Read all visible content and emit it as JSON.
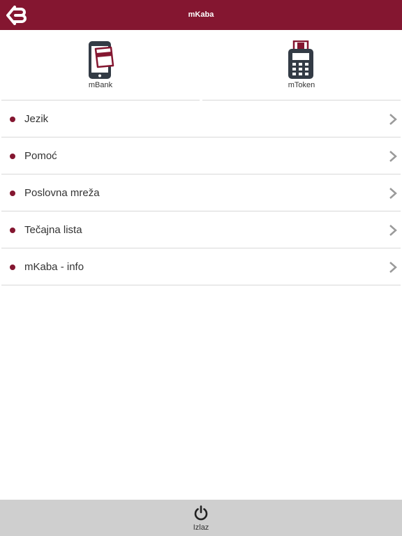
{
  "header": {
    "title": "mKaba",
    "logo_icon": "bank-logo-icon",
    "color": "#841630"
  },
  "tiles": [
    {
      "label": "mBank",
      "icon": "mobile-phone-card-icon"
    },
    {
      "label": "mToken",
      "icon": "token-device-icon"
    }
  ],
  "menu": {
    "items": [
      {
        "label": "Jezik"
      },
      {
        "label": "Pomoć"
      },
      {
        "label": "Poslovna mreža"
      },
      {
        "label": "Tečajna lista"
      },
      {
        "label": "mKaba - info"
      }
    ],
    "bullet_color": "#841630",
    "chevron_icon": "chevron-right-icon"
  },
  "footer": {
    "exit_label": "Izlaz",
    "exit_icon": "power-icon",
    "background": "#cfcfcf"
  }
}
